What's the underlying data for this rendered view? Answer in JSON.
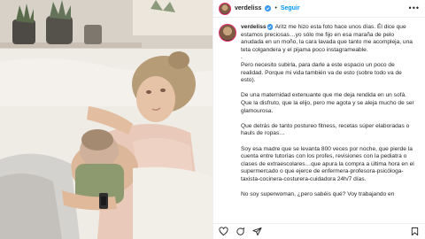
{
  "post": {
    "username": "verdeliss",
    "follow_label": "Seguir",
    "more_label": "•••",
    "separator": "•"
  },
  "caption": {
    "username": "verdeliss",
    "intro": "Aritz me hizo esta foto hace unos días. Él dice que estamos preciosas…yo sólo me fijo en esa maraña de pelo anudada en un moño, la cara lavada que tanto me acompleja, una teta colgandera y el pijama poco instagrameable.",
    "dot": ".",
    "p1": "Pero necesito subirla, para darle a este espacio un poco de realidad. Porque mi vida también va de esto (sobre todo va de esto).",
    "p2": "De una maternidad extenuante que me deja rendida en un sofá. Que la disfruto, que la elijo, pero me agota y se aleja mucho de ser glamourosa.",
    "p3": "Que detrás de tanto postureo fitness, recetas súper elaboradas o hauls de ropas…",
    "p4": "Soy esa madre que se levanta 800 veces por noche, que pierde la cuenta entre tutorías con los profes, revisiones con la pediatra o clases de extraescolares…que apura la compra a última hora en el supermercado o que ejerce de enfermera-profesora-psicóloga-taxista-cocinera-costurera-cuidadora 24h/7 días.",
    "p5": "No soy superwoman, ¿pero sabéis qué? Voy trabajando en"
  },
  "icons": {
    "heart": "heart-icon",
    "comment": "comment-icon",
    "share": "share-icon",
    "bookmark": "bookmark-icon",
    "verified": "verified-badge-icon"
  },
  "colors": {
    "link_blue": "#0095f6",
    "verified_blue": "#3897f0",
    "text": "#262626"
  }
}
